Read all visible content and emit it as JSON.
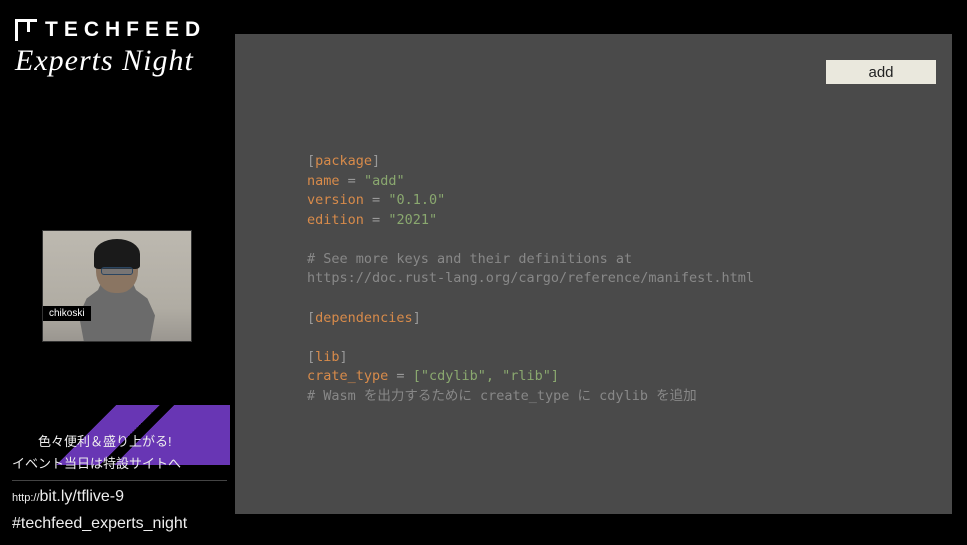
{
  "logo": {
    "brand": "TECHFEED",
    "subtitle": "Experts Night"
  },
  "webcam": {
    "speaker_name": "chikoski"
  },
  "slide": {
    "badge": "add",
    "code": {
      "package_section": "package",
      "name_key": "name",
      "name_val": "\"add\"",
      "version_key": "version",
      "version_val": "\"0.1.0\"",
      "edition_key": "edition",
      "edition_val": "\"2021\"",
      "comment1": "# See more keys and their definitions at",
      "comment2": "https://doc.rust-lang.org/cargo/reference/manifest.html",
      "deps_section": "dependencies",
      "lib_section": "lib",
      "crate_type_key": "crate_type",
      "crate_type_val": "[\"cdylib\", \"rlib\"]",
      "comment3": "# Wasm を出力するために create_type に cdylib を追加"
    }
  },
  "footer": {
    "jp_line1": "色々便利＆盛り上がる!",
    "jp_line2": "イベント当日は特設サイトへ",
    "url_proto": "http://",
    "url_rest": "bit.ly/tflive-9",
    "hashtag": "#techfeed_experts_night"
  }
}
